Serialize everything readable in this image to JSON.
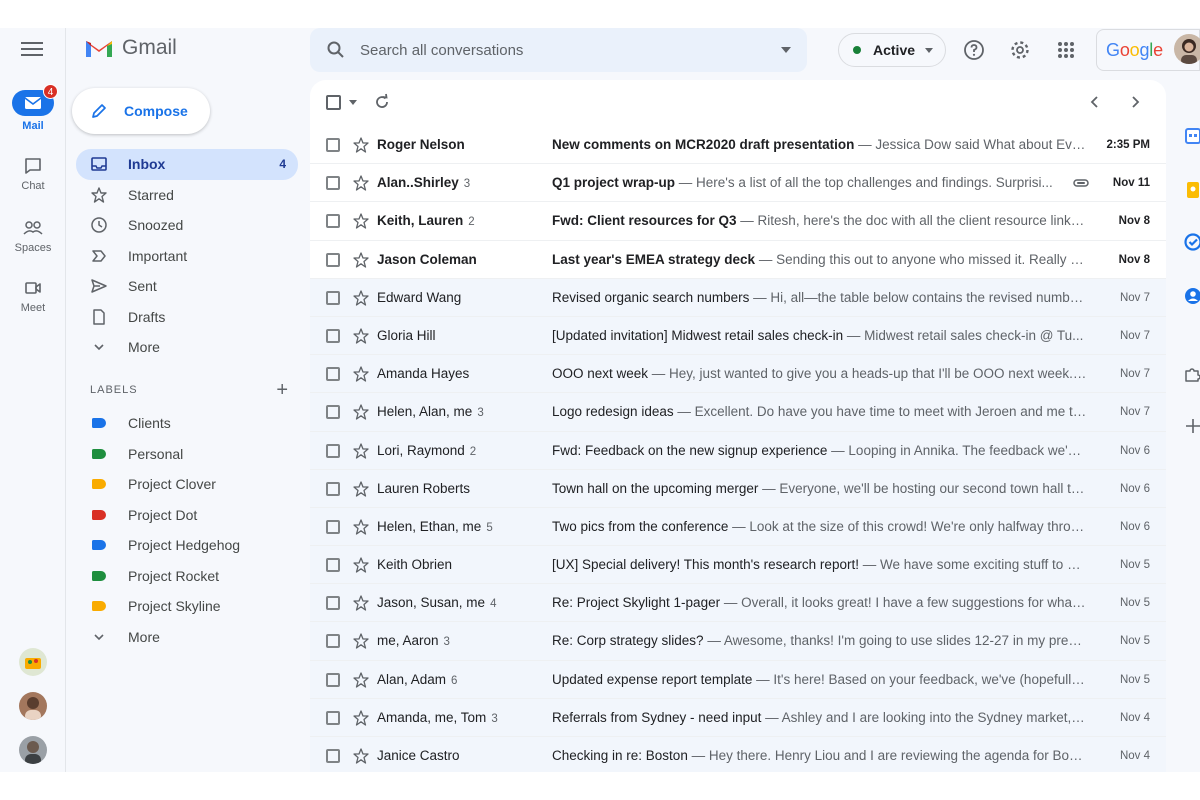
{
  "app": {
    "name": "Gmail",
    "google_word": "Google"
  },
  "rail": {
    "menu_icon": "hamburger-menu-icon",
    "items": [
      {
        "label": "Mail",
        "icon": "mail-icon",
        "badge": "4",
        "active": true
      },
      {
        "label": "Chat",
        "icon": "chat-icon"
      },
      {
        "label": "Spaces",
        "icon": "spaces-icon"
      },
      {
        "label": "Meet",
        "icon": "meet-icon"
      }
    ]
  },
  "compose": {
    "label": "Compose",
    "icon": "pencil-icon"
  },
  "nav": [
    {
      "label": "Inbox",
      "icon": "inbox-icon",
      "count": "4",
      "active": true
    },
    {
      "label": "Starred",
      "icon": "star-icon"
    },
    {
      "label": "Snoozed",
      "icon": "clock-icon"
    },
    {
      "label": "Important",
      "icon": "important-icon"
    },
    {
      "label": "Sent",
      "icon": "send-icon"
    },
    {
      "label": "Drafts",
      "icon": "draft-icon"
    },
    {
      "label": "More",
      "icon": "chevron-down-icon"
    }
  ],
  "labels": {
    "heading": "LABELS",
    "add_symbol": "+",
    "items": [
      {
        "label": "Clients",
        "color": "#1a73e8"
      },
      {
        "label": "Personal",
        "color": "#1e8e3e"
      },
      {
        "label": "Project Clover",
        "color": "#f9ab00"
      },
      {
        "label": "Project Dot",
        "color": "#d93025"
      },
      {
        "label": "Project Hedgehog",
        "color": "#1a73e8"
      },
      {
        "label": "Project Rocket",
        "color": "#1e8e3e"
      },
      {
        "label": "Project Skyline",
        "color": "#f9ab00"
      }
    ],
    "more": "More"
  },
  "search": {
    "placeholder": "Search all conversations"
  },
  "status": {
    "label": "Active",
    "color": "#188038"
  },
  "colors": {
    "accent": "#1a73e8",
    "active_nav": "#d3e3fd",
    "surface": "#f6f8fc",
    "read_row": "#f2f6fc"
  },
  "emails": [
    {
      "sender": "Roger Nelson",
      "count": "",
      "subject": "New comments on MCR2020 draft presentation",
      "snippet": " — Jessica Dow said What about Eva...",
      "date": "2:35 PM",
      "unread": true,
      "attachment": false
    },
    {
      "sender": "Alan..Shirley",
      "count": "3",
      "subject": "Q1 project wrap-up",
      "snippet": " — Here's a list of all the top challenges and findings. Surprisi...",
      "date": "Nov 11",
      "unread": true,
      "attachment": true
    },
    {
      "sender": "Keith, Lauren",
      "count": "2",
      "subject": "Fwd: Client resources for Q3",
      "snippet": " — Ritesh, here's the doc with all the client resource links ...",
      "date": "Nov 8",
      "unread": true,
      "attachment": false
    },
    {
      "sender": "Jason Coleman",
      "count": "",
      "subject": "Last year's EMEA strategy deck",
      "snippet": " — Sending this out to anyone who missed it. Really gr...",
      "date": "Nov 8",
      "unread": true,
      "attachment": false
    },
    {
      "sender": "Edward Wang",
      "count": "",
      "subject": "Revised organic search numbers",
      "snippet": " — Hi, all—the table below contains the revised numbe...",
      "date": "Nov 7",
      "unread": false,
      "attachment": false
    },
    {
      "sender": "Gloria Hill",
      "count": "",
      "subject": "[Updated invitation] Midwest retail sales check-in",
      "snippet": " — Midwest retail sales check-in @ Tu...",
      "date": "Nov 7",
      "unread": false,
      "attachment": false
    },
    {
      "sender": "Amanda Hayes",
      "count": "",
      "subject": "OOO next week",
      "snippet": " — Hey, just wanted to give you a heads-up that I'll be OOO next week. If ...",
      "date": "Nov 7",
      "unread": false,
      "attachment": false
    },
    {
      "sender": "Helen, Alan, me",
      "count": "3",
      "subject": "Logo redesign ideas",
      "snippet": " — Excellent. Do have you have time to meet with Jeroen and me thi...",
      "date": "Nov 7",
      "unread": false,
      "attachment": false
    },
    {
      "sender": "Lori, Raymond",
      "count": "2",
      "subject": "Fwd: Feedback on the new signup experience",
      "snippet": " — Looping in Annika. The feedback we've...",
      "date": "Nov 6",
      "unread": false,
      "attachment": false
    },
    {
      "sender": "Lauren Roberts",
      "count": "",
      "subject": "Town hall on the upcoming merger",
      "snippet": " — Everyone, we'll be hosting our second town hall to ...",
      "date": "Nov 6",
      "unread": false,
      "attachment": false
    },
    {
      "sender": "Helen, Ethan, me",
      "count": "5",
      "subject": "Two pics from the conference",
      "snippet": " — Look at the size of this crowd! We're only halfway throu...",
      "date": "Nov 6",
      "unread": false,
      "attachment": false
    },
    {
      "sender": "Keith Obrien",
      "count": "",
      "subject": "[UX] Special delivery! This month's research report!",
      "snippet": " — We have some exciting stuff to sh...",
      "date": "Nov 5",
      "unread": false,
      "attachment": false
    },
    {
      "sender": "Jason, Susan, me",
      "count": "4",
      "subject": "Re: Project Skylight 1-pager",
      "snippet": " — Overall, it looks great! I have a few suggestions for what t...",
      "date": "Nov 5",
      "unread": false,
      "attachment": false
    },
    {
      "sender": "me, Aaron",
      "count": "3",
      "subject": "Re: Corp strategy slides?",
      "snippet": " — Awesome, thanks! I'm going to use slides 12-27 in my presen...",
      "date": "Nov 5",
      "unread": false,
      "attachment": false
    },
    {
      "sender": "Alan, Adam",
      "count": "6",
      "subject": "Updated expense report template",
      "snippet": " — It's here! Based on your feedback, we've (hopefully)...",
      "date": "Nov 5",
      "unread": false,
      "attachment": false
    },
    {
      "sender": "Amanda, me, Tom",
      "count": "3",
      "subject": "Referrals from Sydney - need input",
      "snippet": " — Ashley and I are looking into the Sydney market, a...",
      "date": "Nov 4",
      "unread": false,
      "attachment": false
    },
    {
      "sender": "Janice Castro",
      "count": "",
      "subject": "Checking in re: Boston",
      "snippet": " — Hey there. Henry Liou and I are reviewing the agenda for Boston...",
      "date": "Nov 4",
      "unread": false,
      "attachment": false
    }
  ]
}
